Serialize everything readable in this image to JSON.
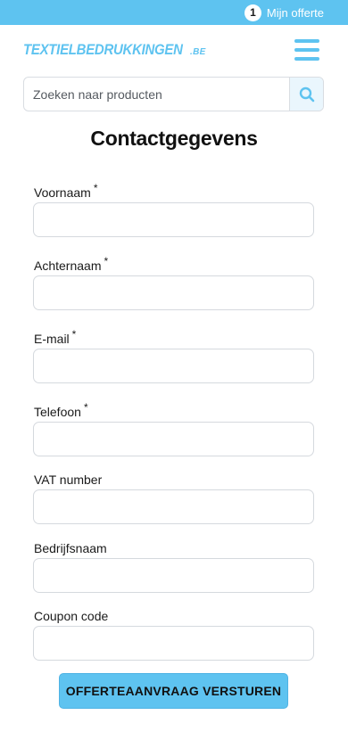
{
  "topbar": {
    "offer_count": "1",
    "offer_label": "Mijn offerte",
    "color": "#5ec3f0"
  },
  "header": {
    "logo_main": "TEXTIELBEDRUKKINGEN",
    "logo_suffix": ".BE",
    "menu_icon": "hamburger-menu-icon"
  },
  "search": {
    "placeholder": "Zoeken naar producten",
    "value": "",
    "icon": "search-icon"
  },
  "page": {
    "title": "Contactgegevens"
  },
  "form": {
    "required_marker": "*",
    "fields": [
      {
        "label": "Voornaam",
        "value": ""
      },
      {
        "label": "Achternaam",
        "value": ""
      },
      {
        "label": "E-mail",
        "value": ""
      },
      {
        "label": "Telefoon",
        "value": ""
      },
      {
        "label": "VAT number",
        "value": ""
      },
      {
        "label": "Bedrijfsnaam",
        "value": ""
      },
      {
        "label": "Coupon code",
        "value": ""
      }
    ],
    "submit_label": "OFFERTEAANVRAAG VERSTUREN"
  },
  "colors": {
    "accent": "#5ec3f0",
    "border": "#d5d9de"
  }
}
